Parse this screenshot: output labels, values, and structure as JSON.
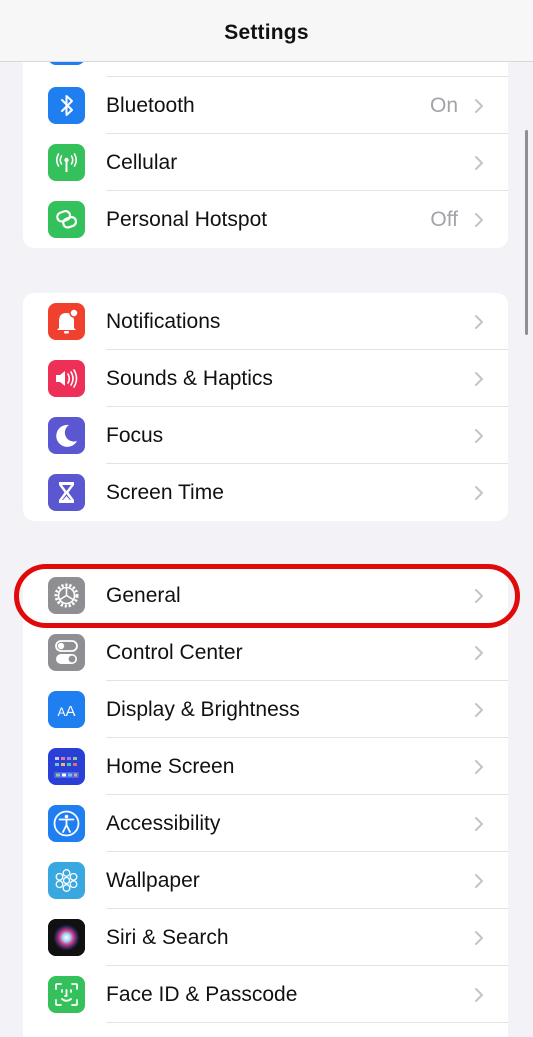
{
  "header": {
    "title": "Settings"
  },
  "colors": {
    "highlight": "#e00a0a",
    "background": "#f2f2f7"
  },
  "groups": [
    {
      "items": [
        {
          "label": "Bluetooth",
          "value": "On",
          "icon": "bluetooth-icon",
          "color": "#1f7ef0"
        },
        {
          "label": "Cellular",
          "value": "",
          "icon": "antenna-icon",
          "color": "#34c05a"
        },
        {
          "label": "Personal Hotspot",
          "value": "Off",
          "icon": "hotspot-link-icon",
          "color": "#34c05a"
        }
      ]
    },
    {
      "items": [
        {
          "label": "Notifications",
          "value": "",
          "icon": "notification-bell-icon",
          "color": "#f0412f"
        },
        {
          "label": "Sounds & Haptics",
          "value": "",
          "icon": "speaker-icon",
          "color": "#ee2f57"
        },
        {
          "label": "Focus",
          "value": "",
          "icon": "moon-icon",
          "color": "#5b57d1"
        },
        {
          "label": "Screen Time",
          "value": "",
          "icon": "hourglass-icon",
          "color": "#5b57d1"
        }
      ]
    },
    {
      "items": [
        {
          "label": "General",
          "value": "",
          "icon": "gear-icon",
          "color": "#8e8e93",
          "highlighted": true
        },
        {
          "label": "Control Center",
          "value": "",
          "icon": "toggles-icon",
          "color": "#8e8e93"
        },
        {
          "label": "Display & Brightness",
          "value": "",
          "icon": "text-size-icon",
          "color": "#1f7ef0"
        },
        {
          "label": "Home Screen",
          "value": "",
          "icon": "app-grid-icon",
          "color": "#2a3fd6"
        },
        {
          "label": "Accessibility",
          "value": "",
          "icon": "accessibility-person-icon",
          "color": "#1f7ef0"
        },
        {
          "label": "Wallpaper",
          "value": "",
          "icon": "flower-icon",
          "color": "#3aa8e0"
        },
        {
          "label": "Siri & Search",
          "value": "",
          "icon": "siri-orb-icon",
          "color": "#1a1a2a"
        },
        {
          "label": "Face ID & Passcode",
          "value": "",
          "icon": "face-id-icon",
          "color": "#34c05a"
        }
      ]
    }
  ],
  "annotation": {
    "label": "General",
    "kind": "red-circle-highlight"
  }
}
